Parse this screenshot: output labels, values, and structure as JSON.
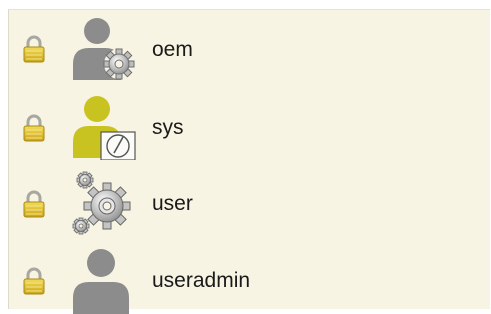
{
  "users": [
    {
      "name": "oem",
      "lock_icon": "padlock-icon",
      "icon": "user-gear-icon"
    },
    {
      "name": "sys",
      "lock_icon": "padlock-icon",
      "icon": "user-clock-icon"
    },
    {
      "name": "user",
      "lock_icon": "padlock-icon",
      "icon": "gears-icon"
    },
    {
      "name": "useradmin",
      "lock_icon": "padlock-icon",
      "icon": "user-icon"
    }
  ],
  "colors": {
    "panel_background": "#f7f4e3",
    "lock_gold": "#e3c233",
    "avatar_gray": "#8c8c8c",
    "avatar_yellow": "#c9c321"
  }
}
